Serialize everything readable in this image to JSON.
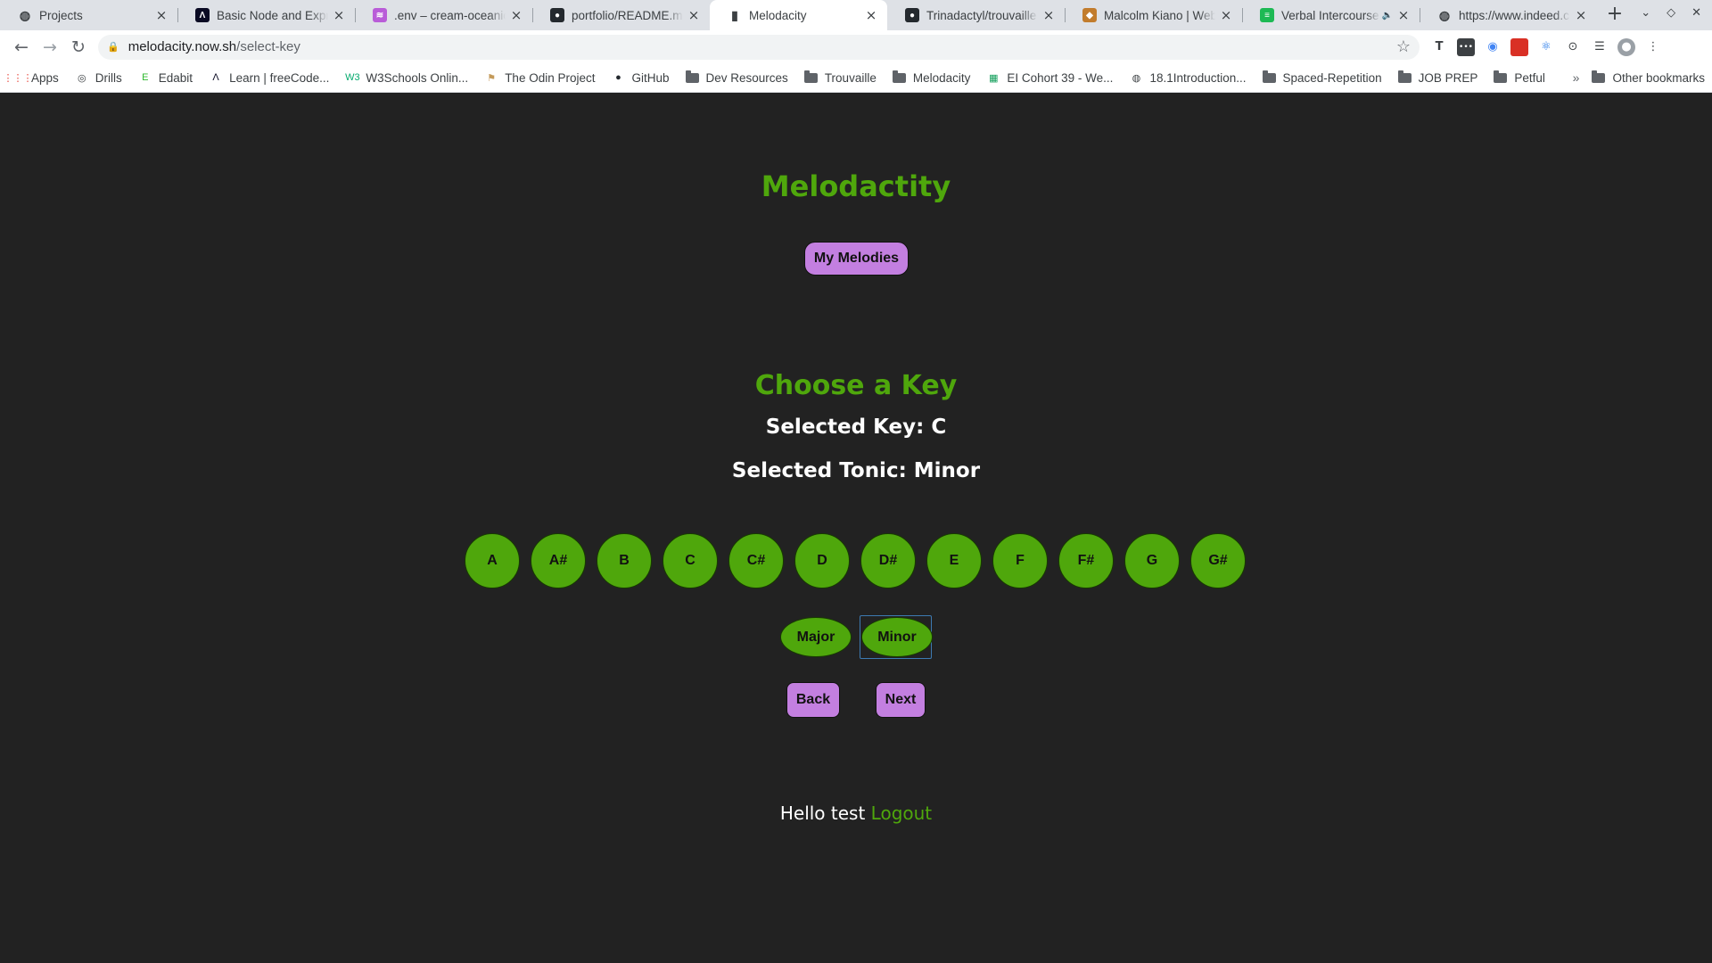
{
  "browser": {
    "tabs": [
      {
        "title": "Projects",
        "icon": "globe-icon",
        "color": "#3c4043"
      },
      {
        "title": "Basic Node and Express",
        "icon": "freecodecamp-icon",
        "color": "#0a0a23"
      },
      {
        "title": ".env – cream-oceanic-",
        "icon": "glitch-icon",
        "color": "#b95cd8"
      },
      {
        "title": "portfolio/README.md",
        "icon": "github-icon",
        "color": "#24292e"
      },
      {
        "title": "Melodacity",
        "icon": "page-icon",
        "color": "#3c4043"
      },
      {
        "title": "Trinadactyl/trouvaille",
        "icon": "github-icon",
        "color": "#24292e"
      },
      {
        "title": "Malcolm Kiano | Web",
        "icon": "portfolio-icon",
        "color": "#c27c2c"
      },
      {
        "title": "Verbal Intercourse",
        "icon": "spotify-icon",
        "color": "#1db954"
      },
      {
        "title": "https://www.indeed.c",
        "icon": "globe-icon",
        "color": "#3c4043"
      }
    ],
    "active_tab": 4,
    "url_host": "melodacity.now.sh",
    "url_path": "/select-key",
    "bookmarks": [
      {
        "label": "Apps",
        "icon": "apps-grid-icon"
      },
      {
        "label": "Drills",
        "icon": "target-icon"
      },
      {
        "label": "Edabit",
        "icon": "edabit-icon"
      },
      {
        "label": "Learn | freeCode...",
        "icon": "freecodecamp-icon"
      },
      {
        "label": "W3Schools Onlin...",
        "icon": "w3schools-icon"
      },
      {
        "label": "The Odin Project",
        "icon": "odin-icon"
      },
      {
        "label": "GitHub",
        "icon": "github-icon"
      },
      {
        "label": "Dev Resources",
        "icon": "folder-icon"
      },
      {
        "label": "Trouvaille",
        "icon": "folder-icon"
      },
      {
        "label": "Melodacity",
        "icon": "folder-icon"
      },
      {
        "label": "EI Cohort 39 - We...",
        "icon": "sheets-icon"
      },
      {
        "label": "18.1Introduction...",
        "icon": "globe-icon"
      },
      {
        "label": "Spaced-Repetition",
        "icon": "folder-icon"
      },
      {
        "label": "JOB PREP",
        "icon": "folder-icon"
      },
      {
        "label": "Petful",
        "icon": "folder-icon"
      }
    ],
    "other_bookmarks": "Other bookmarks"
  },
  "app": {
    "brand": "Melodactity",
    "my_melodies": "My Melodies",
    "heading": "Choose a Key",
    "selected_key": "Selected Key: C",
    "selected_tonic": "Selected Tonic: Minor",
    "keys": [
      "A",
      "A#",
      "B",
      "C",
      "C#",
      "D",
      "D#",
      "E",
      "F",
      "F#",
      "G",
      "G#"
    ],
    "modes": {
      "major": "Major",
      "minor": "Minor"
    },
    "back": "Back",
    "next": "Next",
    "greeting": "Hello test",
    "logout": "Logout"
  },
  "colors": {
    "accent_green": "#4fa70c",
    "button_purple": "#c37fe0",
    "page_bg": "#222222"
  }
}
